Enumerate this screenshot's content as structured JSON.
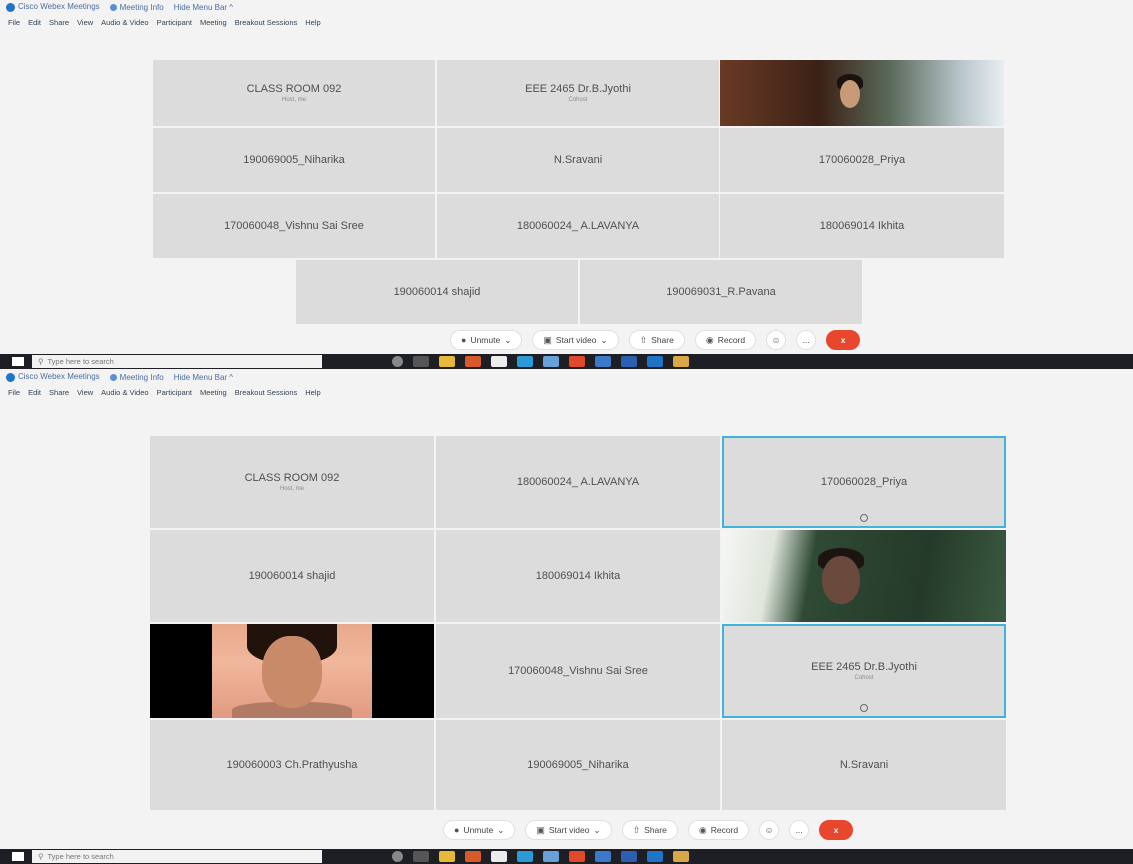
{
  "top_window": {
    "titlebar": {
      "app_name": "Cisco Webex Meetings",
      "meeting_info": "Meeting Info",
      "hide_menu": "Hide Menu Bar ^"
    },
    "menus": [
      "File",
      "Edit",
      "Share",
      "View",
      "Audio & Video",
      "Participant",
      "Meeting",
      "Breakout Sessions",
      "Help"
    ],
    "tiles": [
      {
        "name": "CLASS ROOM 092",
        "sub": "Host, me"
      },
      {
        "name": "EEE 2465 Dr.B.Jyothi",
        "sub": "Cohost"
      },
      {
        "name": "190069005_Niharika"
      },
      {
        "name": "N.Sravani"
      },
      {
        "name": "170060028_Priya"
      },
      {
        "name": "170060048_Vishnu Sai Sree"
      },
      {
        "name": "180060024_ A.LAVANYA"
      },
      {
        "name": "180069014 Ikhita"
      },
      {
        "name": "190060014 shajid"
      },
      {
        "name": "190069031_R.Pavana"
      }
    ]
  },
  "bottom_window": {
    "titlebar": {
      "app_name": "Cisco Webex Meetings",
      "meeting_info": "Meeting Info",
      "hide_menu": "Hide Menu Bar ^"
    },
    "menus": [
      "File",
      "Edit",
      "Share",
      "View",
      "Audio & Video",
      "Participant",
      "Meeting",
      "Breakout Sessions",
      "Help"
    ],
    "tiles": [
      {
        "name": "CLASS ROOM 092",
        "sub": "Host, me"
      },
      {
        "name": "180060024_ A.LAVANYA"
      },
      {
        "name": "170060028_Priya"
      },
      {
        "name": "190060014 shajid"
      },
      {
        "name": "180069014 Ikhita"
      },
      {
        "name": "170060048_Vishnu Sai Sree"
      },
      {
        "name": "EEE 2465 Dr.B.Jyothi",
        "sub": "Cohost"
      },
      {
        "name": "190060003 Ch.Prathyusha"
      },
      {
        "name": "190069005_Niharika"
      },
      {
        "name": "N.Sravani"
      }
    ]
  },
  "controls": {
    "unmute": "Unmute",
    "start_video": "Start video",
    "share": "Share",
    "record": "Record",
    "more": "...",
    "end": "x"
  },
  "taskbar": {
    "search_placeholder": "Type here to search"
  },
  "colors": {
    "accent_active": "#3fb3d9",
    "end_button": "#e8472e",
    "taskbar": "#1d1f24"
  }
}
